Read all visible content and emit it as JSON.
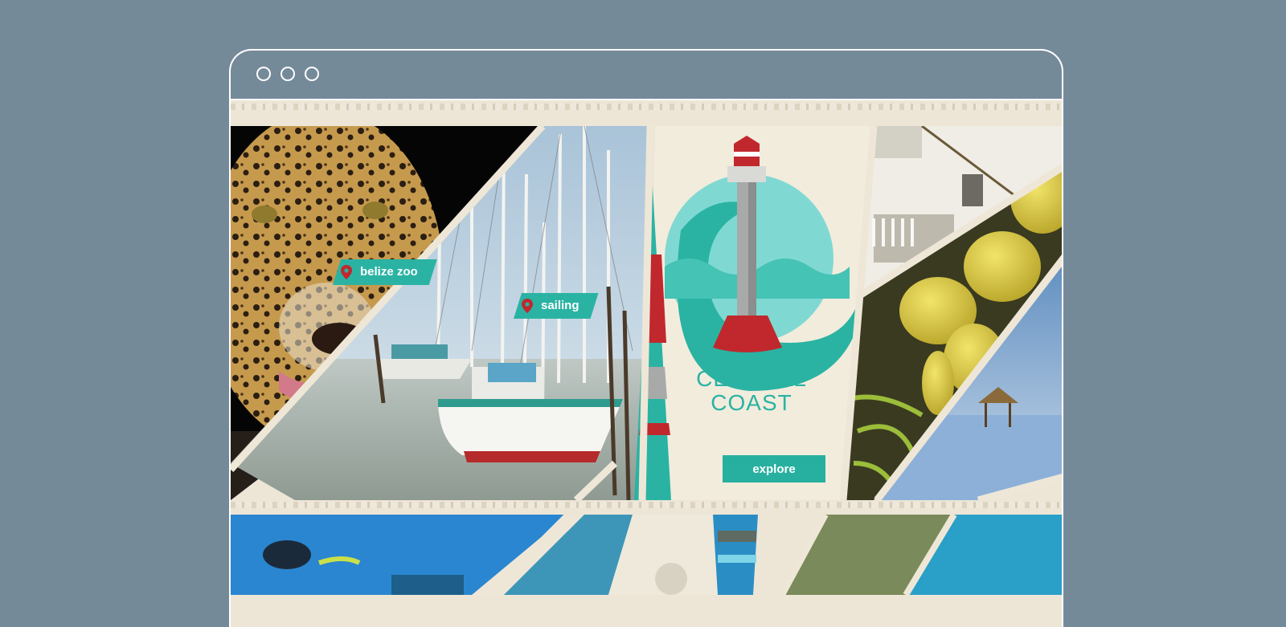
{
  "window": {
    "controls": [
      "window-dot",
      "window-dot",
      "window-dot"
    ]
  },
  "hero": {
    "tags": [
      {
        "label": "belize zoo",
        "icon": "map-pin-icon"
      },
      {
        "label": "sailing",
        "icon": "map-pin-icon"
      }
    ],
    "brand": {
      "line1": "CENTRAL",
      "line2": "COAST",
      "icon": "lighthouse-icon"
    },
    "cta_label": "explore"
  },
  "colors": {
    "background": "#758a99",
    "paper": "#ede6d6",
    "accent_teal": "#2ab3a3",
    "accent_red": "#c0282d",
    "white": "#ffffff"
  }
}
